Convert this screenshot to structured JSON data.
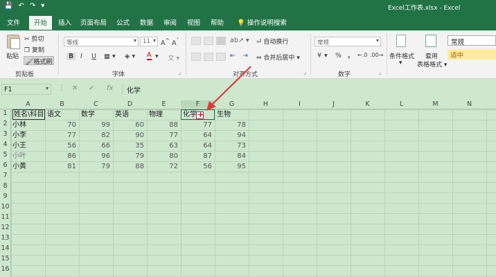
{
  "window": {
    "title": "Excel工作表.xlsx  -  Excel"
  },
  "qat": {
    "save": "💾",
    "undo": "↶",
    "redo": "↷",
    "more": "▾"
  },
  "tabs": [
    "文件",
    "开始",
    "插入",
    "页面布局",
    "公式",
    "数据",
    "审阅",
    "视图",
    "帮助"
  ],
  "tellme": "操作说明搜索",
  "ribbon": {
    "paste": "粘贴",
    "cut": "剪切",
    "copy": "复制",
    "format_painter": "格式刷",
    "clipboard_label": "剪贴板",
    "font_name": "等线",
    "font_size": "11",
    "bold": "B",
    "italic": "I",
    "underline": "U",
    "font_color": "A",
    "font_label": "字体",
    "wrap_text": "自动换行",
    "merge_center": "合并后居中",
    "align_label": "对齐方式",
    "number_format": "常规",
    "currency": "¥",
    "percent": "%",
    "comma": ",",
    "number_label": "数字",
    "conditional_format": "条件格式",
    "table_format_line1": "套用",
    "table_format_line2": "表格格式",
    "style_normal": "常规",
    "style_neutral": "适中"
  },
  "formula_bar": {
    "name_box": "F1",
    "cancel": "✕",
    "confirm": "✓",
    "fx": "fx",
    "content": "化学"
  },
  "columns": [
    "A",
    "B",
    "C",
    "D",
    "E",
    "F",
    "G",
    "H",
    "I",
    "J",
    "K",
    "L",
    "M",
    "N"
  ],
  "rows": [
    "1",
    "2",
    "3",
    "4",
    "5",
    "6",
    "7",
    "8",
    "9",
    "10",
    "11",
    "12",
    "13",
    "14",
    "15",
    "16"
  ],
  "sheet": {
    "headers": [
      "姓名\\科目",
      "语文",
      "数学",
      "英语",
      "物理",
      "化学",
      "生物"
    ],
    "data": [
      [
        "小林",
        "70",
        "99",
        "60",
        "88",
        "77",
        "78"
      ],
      [
        "小李",
        "77",
        "82",
        "90",
        "77",
        "64",
        "94"
      ],
      [
        "小王",
        "56",
        "66",
        "35",
        "63",
        "64",
        "73"
      ],
      [
        "小叶",
        "86",
        "96",
        "79",
        "80",
        "87",
        "84"
      ],
      [
        "小黄",
        "81",
        "79",
        "88",
        "72",
        "56",
        "95"
      ]
    ]
  },
  "colors": {
    "brand": "#217346",
    "sheet_bg": "#cde8cf",
    "annotation_arrow": "#e53935"
  }
}
